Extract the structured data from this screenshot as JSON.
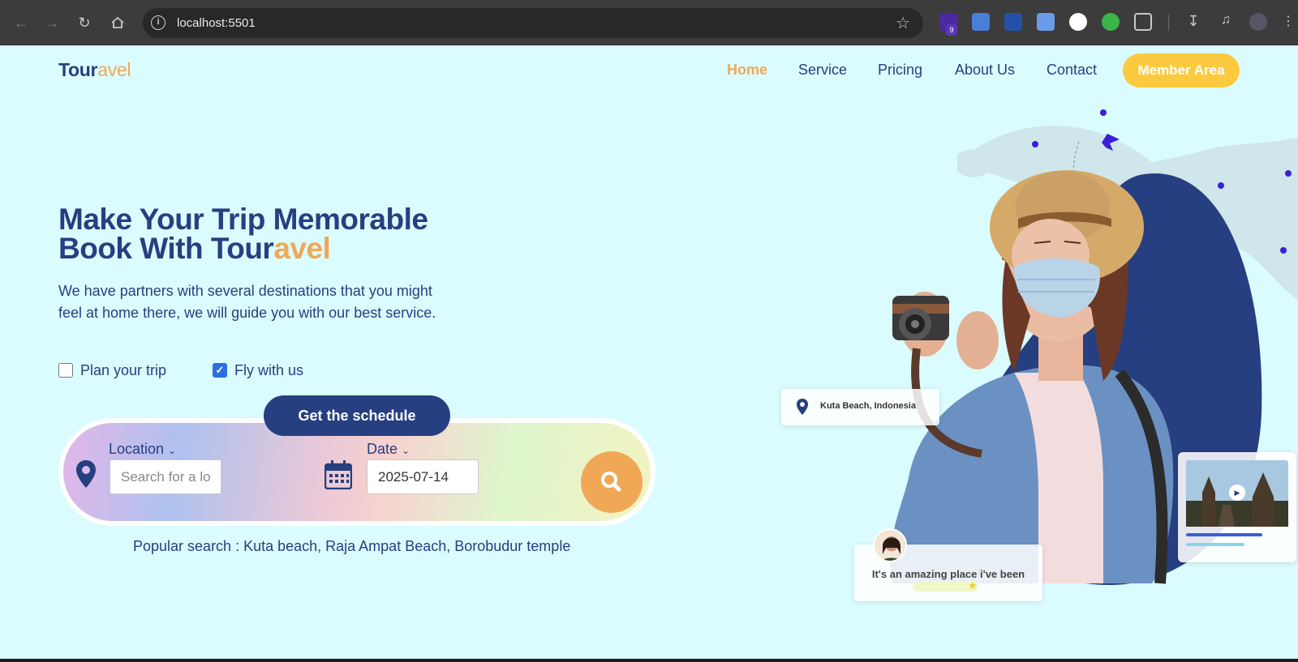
{
  "browser": {
    "url": "localhost:5501",
    "extension_badge": "9"
  },
  "header": {
    "logo_primary": "Tour",
    "logo_accent": "avel",
    "nav": [
      "Home",
      "Service",
      "Pricing",
      "About Us",
      "Contact"
    ],
    "active_nav": "Home",
    "member_button": "Member Area"
  },
  "hero": {
    "title_line1": "Make Your Trip Memorable",
    "title_line2_primary": "Book With Tour",
    "title_line2_accent": "avel",
    "description": "We have partners with several destinations that you might feel at home there, we will guide you with our best service.",
    "options": [
      {
        "label": "Plan your trip",
        "checked": false
      },
      {
        "label": "Fly with us",
        "checked": true
      }
    ],
    "schedule_button": "Get the schedule"
  },
  "search": {
    "location_label": "Location",
    "location_placeholder": "Search for a location",
    "date_label": "Date",
    "date_value": "2025-07-14",
    "popular": "Popular search : Kuta beach, Raja Ampat Beach, Borobudur temple"
  },
  "cards": {
    "location": "Kuta Beach, Indonesia",
    "review": "It's an amazing place i've been"
  },
  "colors": {
    "navy": "#263f80",
    "orange": "#f0a857",
    "yellow": "#fcca3e",
    "background": "#dafcfe"
  }
}
